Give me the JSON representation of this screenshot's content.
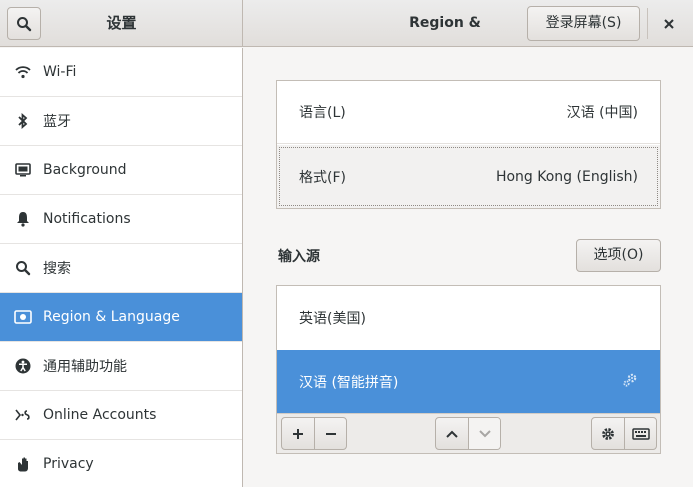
{
  "header": {
    "left_title": "设置",
    "title": "Region & Language",
    "login_screen_button": "登录屏幕(S)"
  },
  "sidebar": {
    "items": [
      {
        "label": "Wi-Fi",
        "icon": "wifi-icon"
      },
      {
        "label": "蓝牙",
        "icon": "bluetooth-icon"
      },
      {
        "label": "Background",
        "icon": "background-icon"
      },
      {
        "label": "Notifications",
        "icon": "bell-icon"
      },
      {
        "label": "搜索",
        "icon": "search-icon"
      },
      {
        "label": "Region & Language",
        "icon": "flag-icon",
        "active": true
      },
      {
        "label": "通用辅助功能",
        "icon": "accessibility-icon"
      },
      {
        "label": "Online Accounts",
        "icon": "online-accounts-icon"
      },
      {
        "label": "Privacy",
        "icon": "hand-icon"
      }
    ]
  },
  "language_card": {
    "language_label": "语言(L)",
    "language_value": "汉语 (中国)",
    "formats_label": "格式(F)",
    "formats_value": "Hong Kong (English)"
  },
  "input_sources": {
    "title": "输入源",
    "options_button": "选项(O)",
    "items": [
      {
        "label": "英语(美国)",
        "active": false
      },
      {
        "label": "汉语 (智能拼音)",
        "active": true,
        "icon": "gear-icon"
      }
    ]
  },
  "colors": {
    "accent": "#4a90d9"
  }
}
